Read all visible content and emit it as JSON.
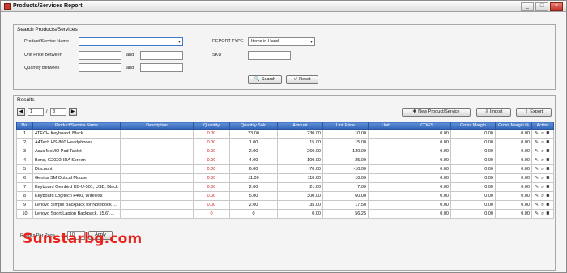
{
  "window": {
    "title": "Products/Services Report",
    "minimize": "_",
    "maximize": "□",
    "close": "×"
  },
  "search": {
    "panel_title": "Search Products/Services",
    "product_label": "Product/Service Name",
    "product_value": "",
    "unit_price_label": "Unit Price Between",
    "unit_price_from": "",
    "unit_price_to": "",
    "and_label": "and",
    "quantity_label": "Quantity Between",
    "quantity_from": "",
    "quantity_to": "",
    "report_type_label": "REPORT TYPE",
    "report_type_value": "Items in Hand",
    "sku_label": "SKU",
    "sku_value": "",
    "search_button": "Search",
    "reset_button": "Reset"
  },
  "results": {
    "panel_title": "Results",
    "page_current": "1",
    "page_sep": "/",
    "page_total": "3",
    "prev_icon": "◀",
    "next_icon": "▶",
    "new_button": "New Product/Service",
    "import_button": "Import",
    "export_button": "Export",
    "columns": [
      "No.",
      "Product/Service Name",
      "Description",
      "Quantity",
      "Quantity Sold",
      "Amount",
      "Unit Price",
      "Unit",
      "COGS",
      "Gross Margin",
      "Gross Margin %",
      "Action"
    ],
    "rows": [
      [
        "1",
        "4TECH Keyboard, Black",
        "",
        "0.00",
        "23.00",
        "230.00",
        "10.00",
        "",
        "0.00",
        "0.00",
        "0.00"
      ],
      [
        "2",
        "A4Tech HS-800 Headphones",
        "",
        "0.00",
        "1.00",
        "15.00",
        "15.00",
        "",
        "0.00",
        "0.00",
        "0.00"
      ],
      [
        "3",
        "Asus MeMO Pad Tablet",
        "",
        "0.00",
        "2.00",
        "260.00",
        "130.00",
        "",
        "0.00",
        "0.00",
        "0.00"
      ],
      [
        "4",
        "Benq, G2020HDA Screen",
        "",
        "0.00",
        "4.00",
        "100.00",
        "25.00",
        "",
        "0.00",
        "0.00",
        "0.00"
      ],
      [
        "5",
        "Discount",
        "",
        "0.00",
        "6.00",
        "-70.00",
        "-10.00",
        "",
        "0.00",
        "0.00",
        "0.00"
      ],
      [
        "6",
        "Genius SM Optical Mouse",
        "",
        "0.00",
        "11.00",
        "110.00",
        "10.00",
        "",
        "0.00",
        "0.00",
        "0.00"
      ],
      [
        "7",
        "Keyboard Gembird KB-U-301, USB, Black",
        "",
        "0.00",
        "2.00",
        "21.00",
        "7.00",
        "",
        "0.00",
        "0.00",
        "0.00"
      ],
      [
        "8",
        "Keyboard Logitech k400, Wireless",
        "",
        "0.00",
        "5.00",
        "300.00",
        "60.00",
        "",
        "0.00",
        "0.00",
        "0.00"
      ],
      [
        "9",
        "Lenovo Simple Backpack for Notebook ...",
        "",
        "0.00",
        "2.00",
        "35.00",
        "17.50",
        "",
        "0.00",
        "0.00",
        "0.00"
      ],
      [
        "10",
        "Lenovo Sport Laptop Backpack, 15.6\",...",
        "",
        "0",
        "0",
        "0.00",
        "56.25",
        "",
        "0.00",
        "0.00",
        "0.00"
      ]
    ],
    "rows_per_page_label": "Results Per Page",
    "rows_per_page_value": "10",
    "apply_button": "Apply"
  },
  "watermark": "Sunstarbg.com",
  "colors": {
    "header_blue": "#3366bb",
    "qty_red": "#d02020",
    "watermark_red": "#e8231b"
  }
}
